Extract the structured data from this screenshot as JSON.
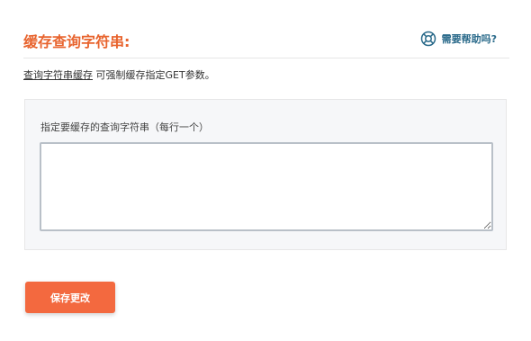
{
  "header": {
    "title": "缓存查询字符串:",
    "help_label": "需要帮助吗?"
  },
  "description": {
    "link_text": "查询字符串缓存",
    "text": " 可强制缓存指定GET参数。"
  },
  "field": {
    "label": "指定要缓存的查询字符串（每行一个）",
    "value": ""
  },
  "actions": {
    "save_label": "保存更改"
  },
  "colors": {
    "accent": "#e8642e",
    "button": "#f3693f",
    "help": "#2a6a8a"
  }
}
